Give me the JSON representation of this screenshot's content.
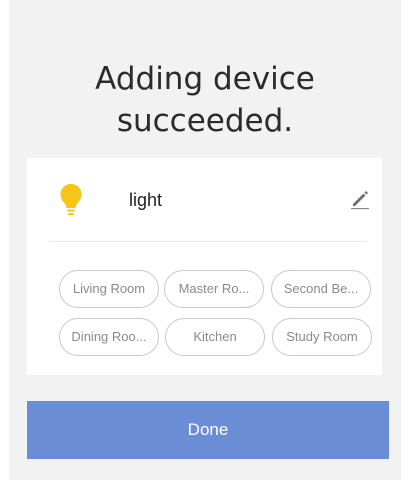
{
  "dialog": {
    "title_line1": "Adding device",
    "title_line2": "succeeded."
  },
  "device": {
    "icon": "lightbulb-icon",
    "icon_color": "#f5c518",
    "name": "light",
    "edit_icon": "pencil-icon"
  },
  "rooms": [
    {
      "label": "Living Room"
    },
    {
      "label": "Master Ro..."
    },
    {
      "label": "Second Be..."
    },
    {
      "label": "Dining Roo..."
    },
    {
      "label": "Kitchen"
    },
    {
      "label": "Study Room"
    }
  ],
  "actions": {
    "done_label": "Done",
    "done_color": "#6b8dd6"
  }
}
